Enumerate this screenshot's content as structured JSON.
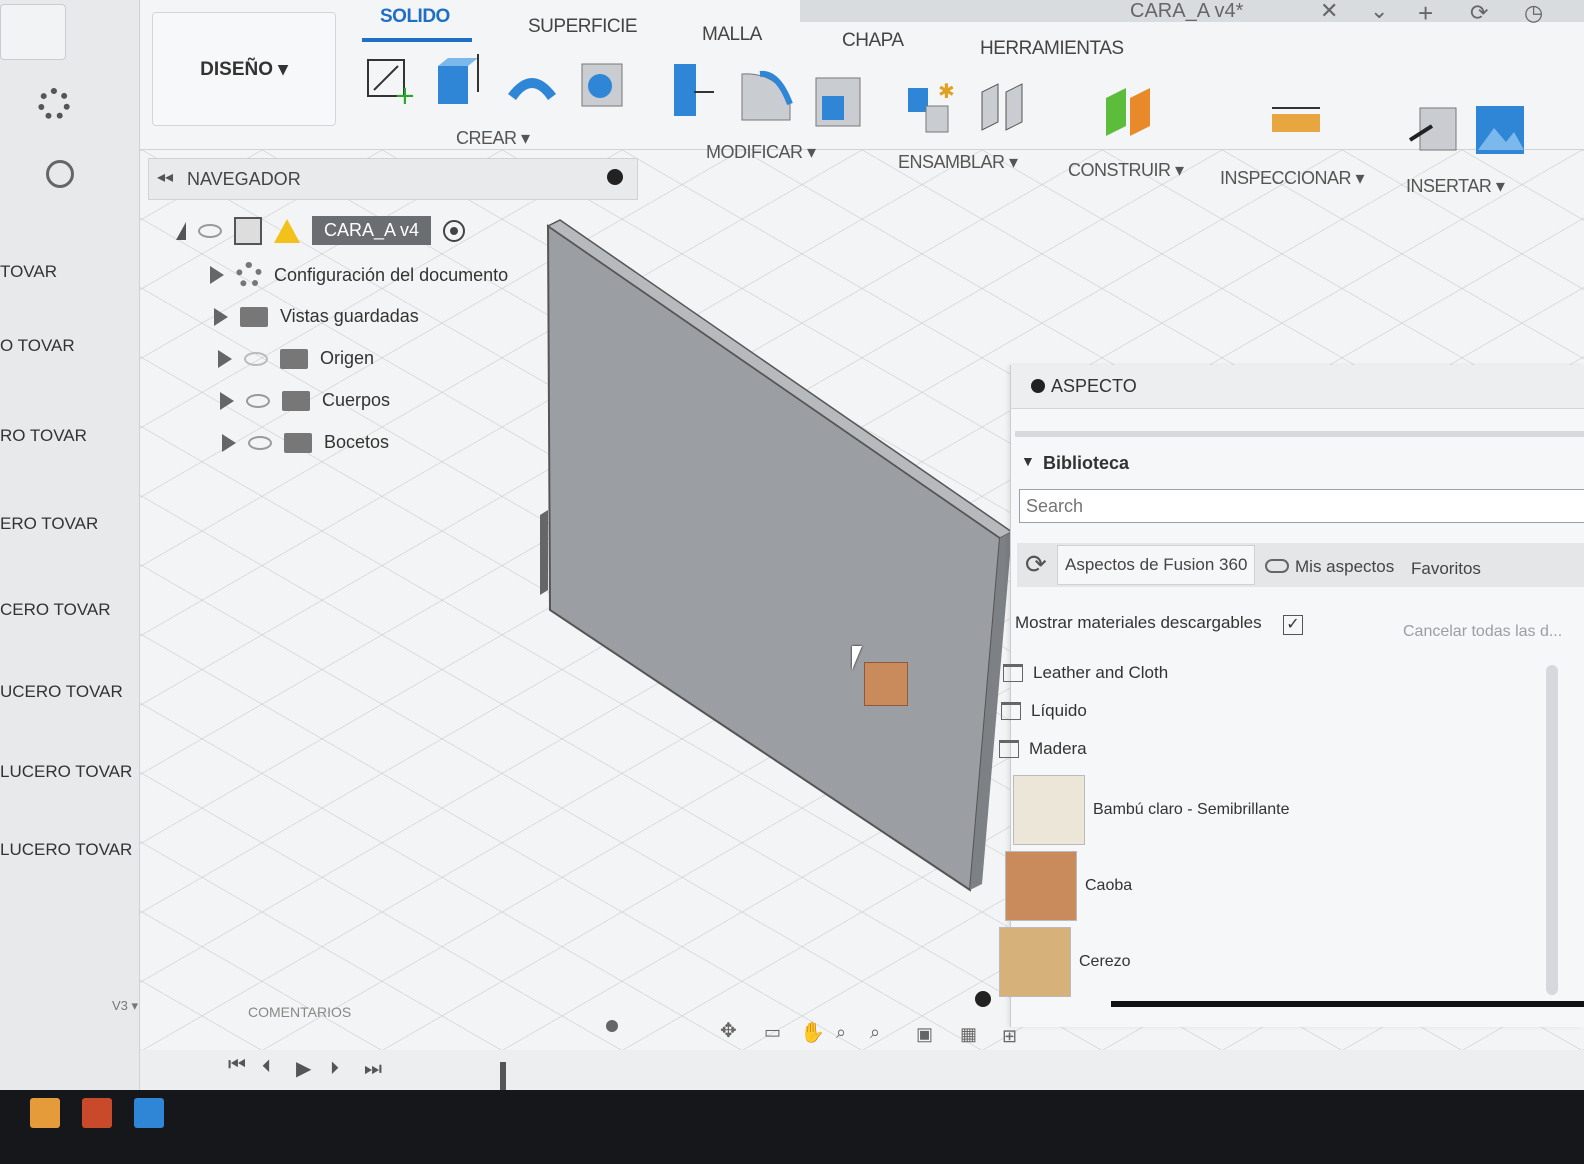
{
  "app": {
    "file_tab": "CARA_A v4*"
  },
  "workspace": {
    "label": "DISEÑO ▾"
  },
  "ribbon": {
    "tabs": [
      "SOLIDO",
      "SUPERFICIE",
      "MALLA",
      "CHAPA",
      "HERRAMIENTAS"
    ],
    "active_tab": "SOLIDO",
    "groups": [
      "CREAR ▾",
      "MODIFICAR ▾",
      "ENSAMBLAR ▾",
      "CONSTRUIR ▾",
      "INSPECCIONAR ▾",
      "INSERTAR ▾"
    ]
  },
  "left_list": [
    "TOVAR",
    "O TOVAR",
    "RO TOVAR",
    "ERO TOVAR",
    "CERO TOVAR",
    "UCERO TOVAR",
    "LUCERO TOVAR",
    "LUCERO TOVAR"
  ],
  "left_bottom": "V3 ▾",
  "navigator": {
    "title": "NAVEGADOR",
    "root": "CARA_A v4",
    "items": [
      "Configuración del documento",
      "Vistas guardadas",
      "Origen",
      "Cuerpos",
      "Bocetos"
    ]
  },
  "comments_label": "COMENTARIOS",
  "appearance": {
    "title": "ASPECTO",
    "library": "Biblioteca",
    "search_placeholder": "Search",
    "tabs": [
      "Aspectos de Fusion 360",
      "Mis aspectos",
      "Favoritos"
    ],
    "show_downloadable": "Mostrar materiales descargables",
    "cancel_all": "Cancelar todas las d...",
    "categories": [
      "Leather and Cloth",
      "Líquido",
      "Madera"
    ],
    "materials": [
      {
        "name": "Bambú claro - Semibrillante",
        "color": "#ece6d8"
      },
      {
        "name": "Caoba",
        "color": "#c98a5c"
      },
      {
        "name": "Cerezo",
        "color": "#d7b17a"
      }
    ]
  },
  "colors": {
    "accent": "#1f6fc5",
    "body": "#9b9ea2"
  }
}
